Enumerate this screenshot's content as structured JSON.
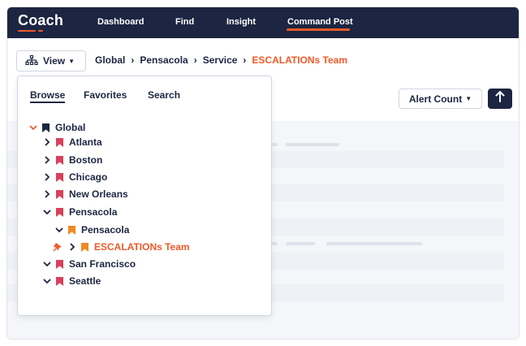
{
  "app": {
    "logo": "Coach"
  },
  "nav": {
    "items": [
      {
        "label": "Dashboard",
        "active": false
      },
      {
        "label": "Find",
        "active": false
      },
      {
        "label": "Insight",
        "active": false
      },
      {
        "label": "Command Post",
        "active": true
      }
    ]
  },
  "view_button": {
    "label": "View"
  },
  "breadcrumb": [
    "Global",
    "Pensacola",
    "Service",
    "ESCALATIONs Team"
  ],
  "toolbar": {
    "alert_count_label": "Alert Count"
  },
  "panel": {
    "tabs": [
      {
        "label": "Browse",
        "active": true
      },
      {
        "label": "Favorites",
        "active": false
      },
      {
        "label": "Search",
        "active": false
      }
    ],
    "tree": [
      {
        "label": "Global",
        "chevron": "down",
        "color": "#1c2541"
      },
      {
        "label": "Atlanta",
        "chevron": "right",
        "color": "#d9405b"
      },
      {
        "label": "Boston",
        "chevron": "right",
        "color": "#d9405b"
      },
      {
        "label": "Chicago",
        "chevron": "right",
        "color": "#d9405b"
      },
      {
        "label": "New Orleans",
        "chevron": "right",
        "color": "#d9405b"
      },
      {
        "label": "Pensacola",
        "chevron": "down",
        "color": "#d9405b"
      },
      {
        "label": "Pensacola",
        "chevron": "down",
        "color": "#f08a24"
      },
      {
        "label": "ESCALATIONs Team",
        "chevron": "right",
        "color": "#f08a24",
        "selected": true,
        "pinned": true
      },
      {
        "label": "San Francisco",
        "chevron": "down",
        "color": "#d9405b"
      },
      {
        "label": "Seattle",
        "chevron": "down",
        "color": "#d9405b"
      }
    ]
  },
  "colors": {
    "navy": "#1c2541",
    "accent": "#ef5a28",
    "bookmark_red": "#d9405b",
    "bookmark_orange": "#f08a24"
  }
}
